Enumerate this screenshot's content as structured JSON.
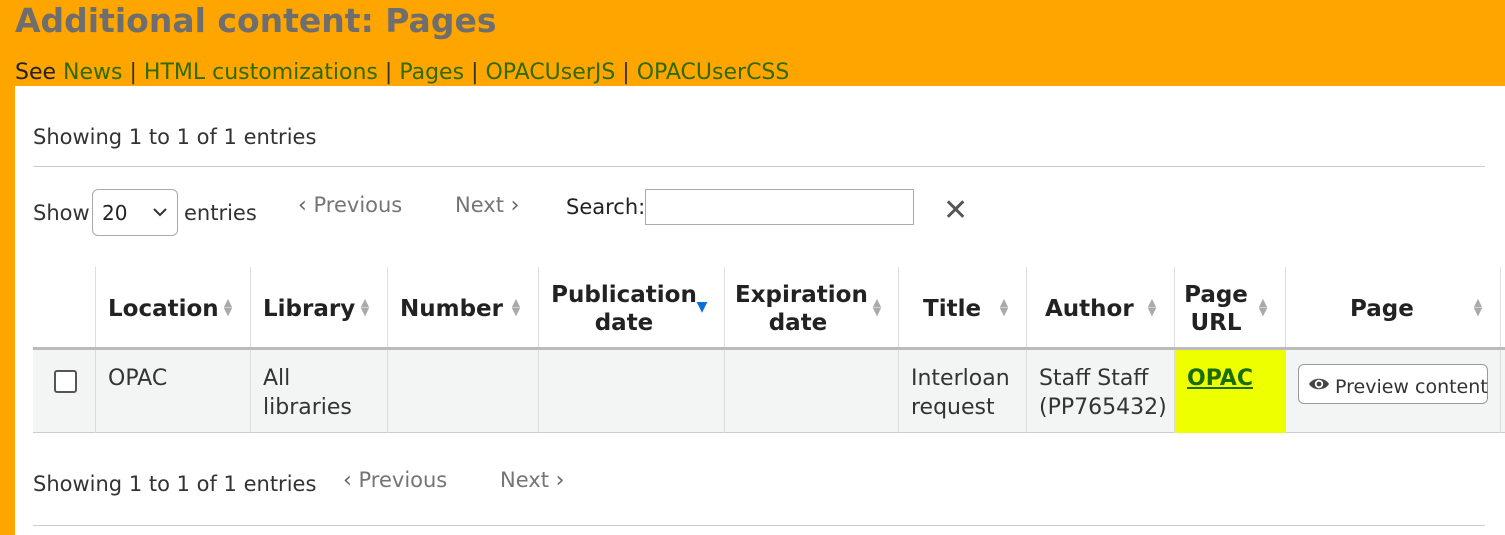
{
  "page": {
    "title": "Additional content: Pages",
    "see_prefix": "See",
    "see_links": [
      "News",
      "HTML customizations",
      "Pages",
      "OPACUserJS",
      "OPACUserCSS"
    ],
    "separator": "|"
  },
  "table_info": {
    "top_text": "Showing 1 to 1 of 1 entries",
    "bottom_text": "Showing 1 to 1 of 1 entries"
  },
  "controls": {
    "show_label": "Show",
    "entries_label": "entries",
    "page_size": "20",
    "previous_label": "Previous",
    "next_label": "Next",
    "search_label": "Search:",
    "search_value": "",
    "clear_glyph": "✕"
  },
  "columns": [
    {
      "label": "",
      "sort": "none"
    },
    {
      "label": "Location",
      "sort": "both"
    },
    {
      "label": "Library",
      "sort": "both"
    },
    {
      "label": "Number",
      "sort": "both"
    },
    {
      "label_line1": "Publication",
      "label_line2": "date",
      "sort": "desc"
    },
    {
      "label_line1": "Expiration",
      "label_line2": "date",
      "sort": "both"
    },
    {
      "label": "Title",
      "sort": "both"
    },
    {
      "label": "Author",
      "sort": "both"
    },
    {
      "label_line1": "Page",
      "label_line2": "URL",
      "sort": "both"
    },
    {
      "label": "Page",
      "sort": "both"
    }
  ],
  "rows": [
    {
      "checked": false,
      "location": "OPAC",
      "library_line1": "All",
      "library_line2": "libraries",
      "number": "",
      "publication_date": "",
      "expiration_date": "",
      "title_line1": "Interloan",
      "title_line2": "request",
      "author_line1": "Staff Staff",
      "author_line2": "(PP765432)",
      "page_url": "OPAC",
      "page_url_highlight": "#eeff00",
      "action_label": "Preview content"
    }
  ],
  "colors": {
    "background": "#ffa500",
    "link": "#2f6b00",
    "sort_active": "#0a6fd6"
  },
  "icons": {
    "sort": "sort-both-icon",
    "sort_desc": "sort-desc-icon",
    "preview": "eye-icon",
    "chevron_left": "chevron-left-icon",
    "chevron_right": "chevron-right-icon",
    "dropdown": "chevron-down-icon",
    "clear": "close-icon"
  }
}
